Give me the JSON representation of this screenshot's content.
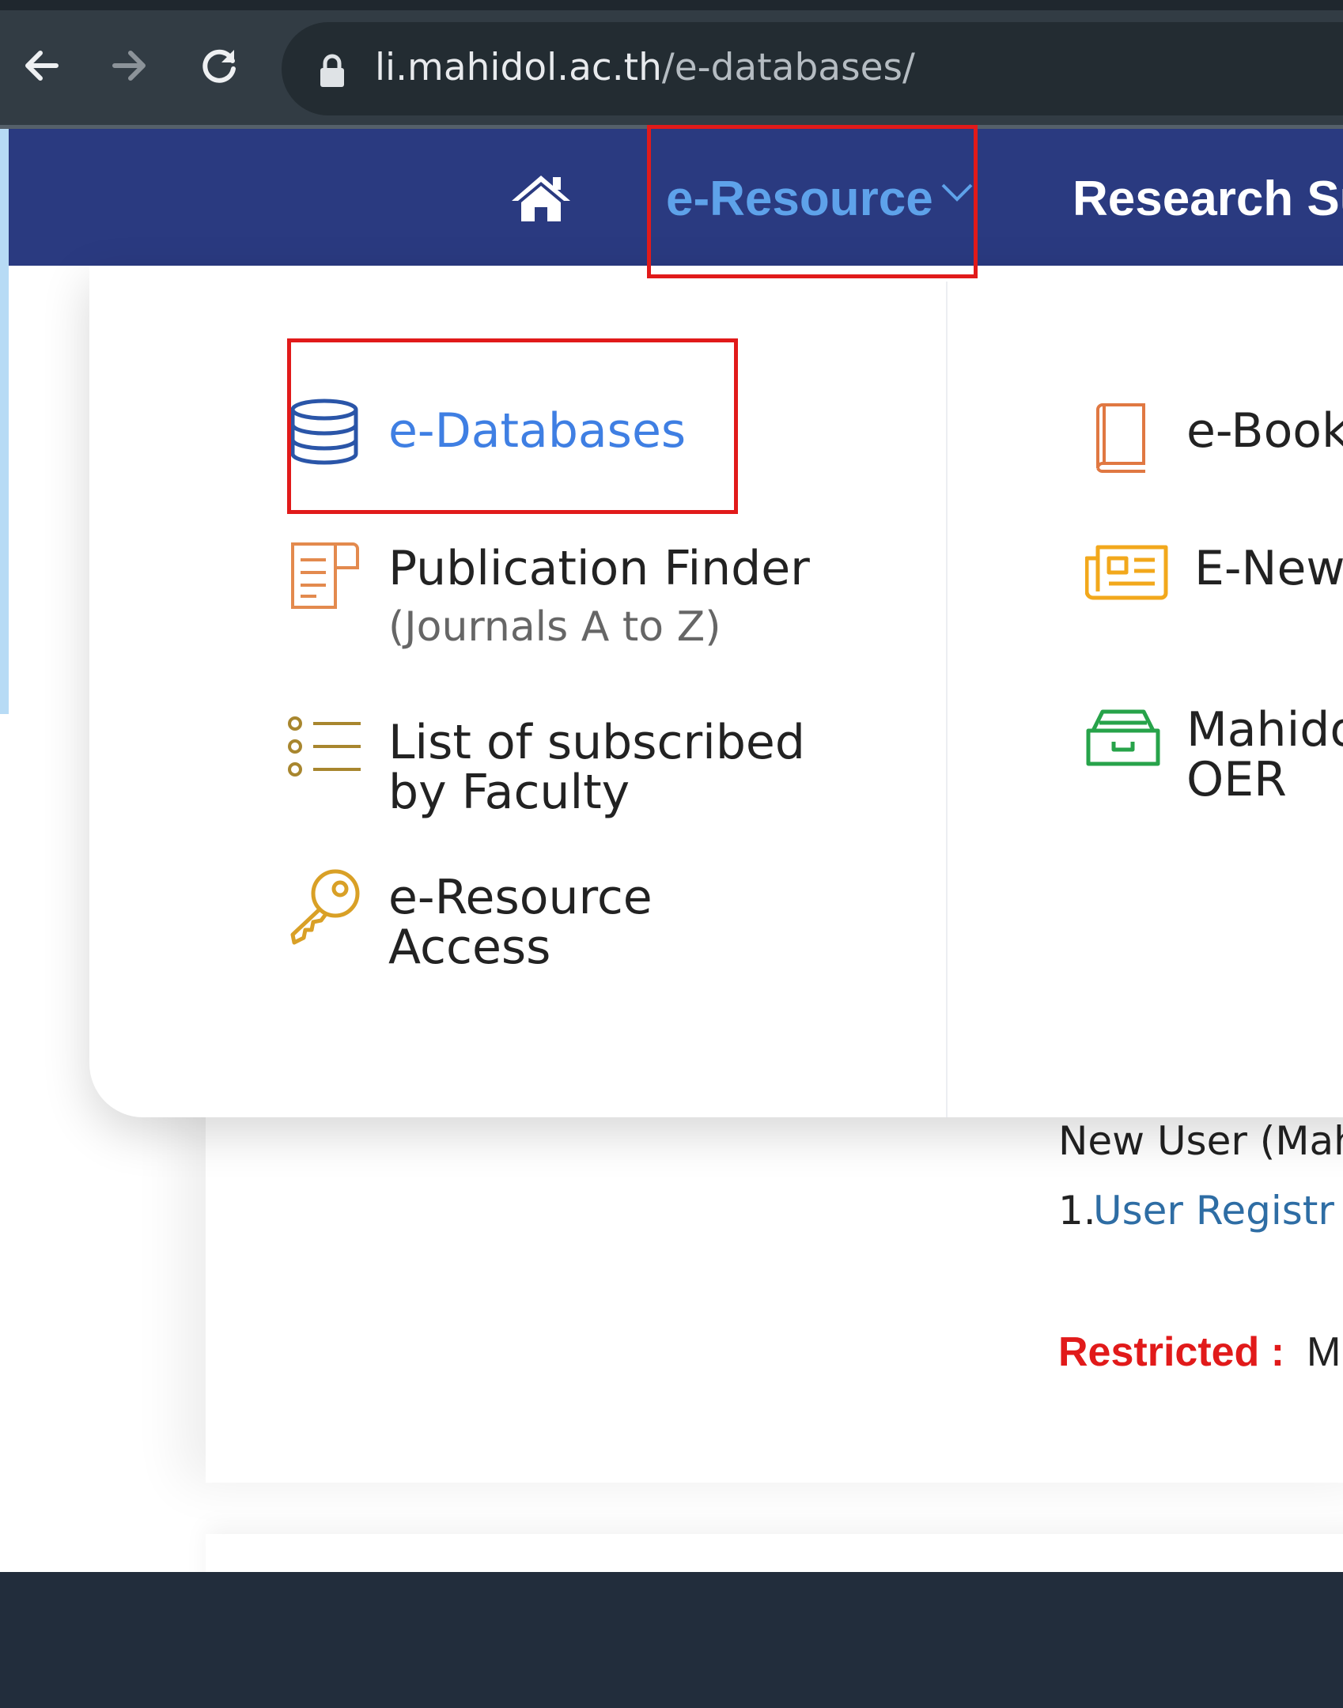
{
  "browser": {
    "url_host": "li.mahidol.ac.th",
    "url_path": "/e-databases/",
    "back_icon": "arrow-left-icon",
    "forward_icon": "arrow-right-icon",
    "reload_icon": "reload-icon",
    "lock_icon": "lock-icon"
  },
  "nav": {
    "home_icon": "home-icon",
    "items": [
      {
        "label": "e-Resource",
        "active": true,
        "has_dropdown": true
      },
      {
        "label": "Research Su"
      }
    ]
  },
  "dropdown": {
    "left_column": [
      {
        "label": "e-Databases",
        "icon": "database-icon",
        "active": true
      },
      {
        "label": "Publication Finder",
        "sublabel": "(Journals A to Z)",
        "icon": "document-icon"
      },
      {
        "label_line1": "List of subscribed",
        "label_line2": "by Faculty",
        "icon": "list-icon"
      },
      {
        "label_line1": "e-Resource",
        "label_line2": "Access",
        "icon": "key-icon"
      }
    ],
    "right_column": [
      {
        "label": "e-Book",
        "icon": "book-icon"
      },
      {
        "label": "E-New",
        "icon": "newspaper-icon"
      },
      {
        "label_line1": "Mahido",
        "label_line2": "OER",
        "icon": "archive-icon"
      }
    ]
  },
  "page": {
    "new_user_text": "New User (Mah",
    "registration_number": "1.",
    "registration_link": "User Registr",
    "restricted_label": "Restricted :",
    "restricted_text": "M"
  },
  "colors": {
    "nav_bg": "#2a3a80",
    "active": "#5ea2ea",
    "highlight": "#e11a1a",
    "footer_bg": "#222d3c"
  }
}
